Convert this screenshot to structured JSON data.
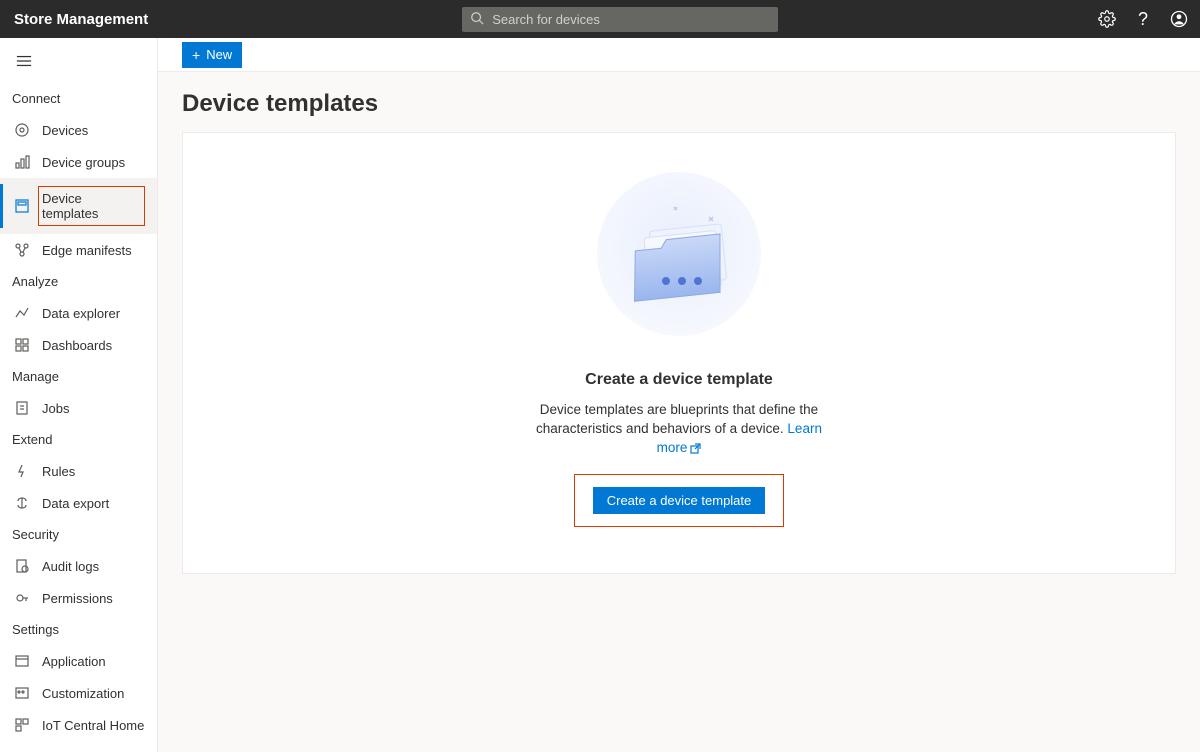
{
  "header": {
    "title": "Store Management",
    "search_placeholder": "Search for devices"
  },
  "sidebar": {
    "sections": [
      {
        "label": "Connect",
        "items": [
          {
            "label": "Devices"
          },
          {
            "label": "Device groups"
          },
          {
            "label": "Device templates",
            "active": true,
            "highlight": true
          },
          {
            "label": "Edge manifests"
          }
        ]
      },
      {
        "label": "Analyze",
        "items": [
          {
            "label": "Data explorer"
          },
          {
            "label": "Dashboards"
          }
        ]
      },
      {
        "label": "Manage",
        "items": [
          {
            "label": "Jobs"
          }
        ]
      },
      {
        "label": "Extend",
        "items": [
          {
            "label": "Rules"
          },
          {
            "label": "Data export"
          }
        ]
      },
      {
        "label": "Security",
        "items": [
          {
            "label": "Audit logs"
          },
          {
            "label": "Permissions"
          }
        ]
      },
      {
        "label": "Settings",
        "items": [
          {
            "label": "Application"
          },
          {
            "label": "Customization"
          },
          {
            "label": "IoT Central Home"
          }
        ]
      }
    ]
  },
  "toolbar": {
    "new_label": "New"
  },
  "page": {
    "title": "Device templates"
  },
  "empty_state": {
    "heading": "Create a device template",
    "description_before_link": "Device templates are blueprints that define the characteristics and behaviors of a device. ",
    "learn_more_label": "Learn more",
    "cta_label": "Create a device template"
  }
}
